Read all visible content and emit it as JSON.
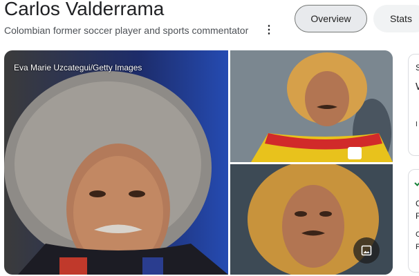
{
  "header": {
    "title": "Carlos Valderrama",
    "subtitle": "Colombian former soccer player and sports commentator"
  },
  "tabs": [
    {
      "label": "Overview",
      "selected": true
    },
    {
      "label": "Stats",
      "selected": false
    }
  ],
  "images": {
    "main_credit": "Eva Marie Uzcategui/Getty Images"
  },
  "side_cards": {
    "card1": {
      "line1": "S",
      "line2": "W",
      "line3": "I"
    },
    "card2": {
      "line1": "C",
      "line2": "F",
      "line3": "C",
      "line4": "F"
    }
  },
  "colors": {
    "accent_chip_border": "#747775",
    "chip_selected_bg": "#e8eaed",
    "chip_bg": "#f1f3f4"
  }
}
